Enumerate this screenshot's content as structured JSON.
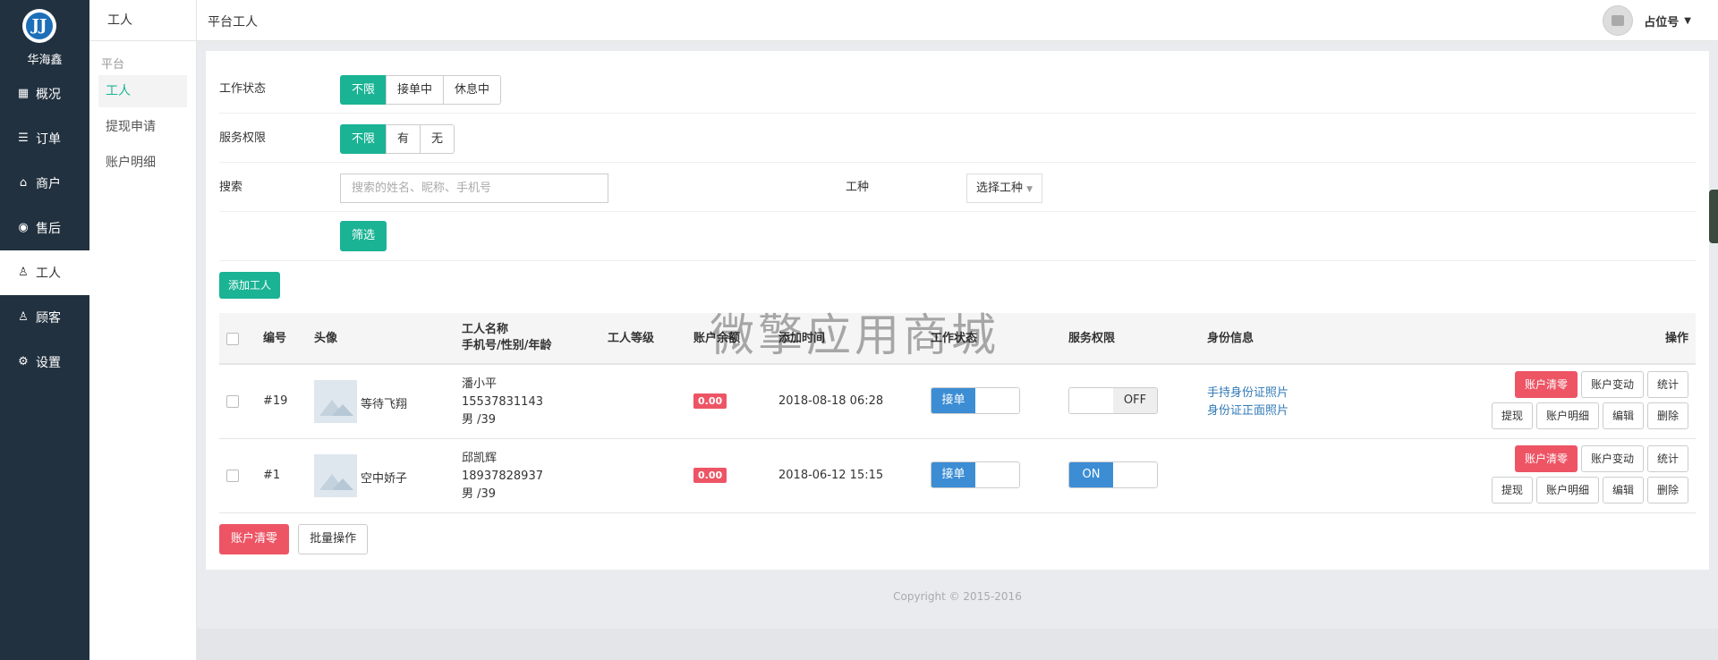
{
  "brand": {
    "name": "华海鑫"
  },
  "sidebar": {
    "items": [
      {
        "label": "概况",
        "icon": "dashboard-icon"
      },
      {
        "label": "订单",
        "icon": "document-icon"
      },
      {
        "label": "商户",
        "icon": "store-icon"
      },
      {
        "label": "售后",
        "icon": "aftersale-icon"
      },
      {
        "label": "工人",
        "icon": "user-icon",
        "active": true
      },
      {
        "label": "顾客",
        "icon": "customer-icon"
      },
      {
        "label": "设置",
        "icon": "gear-icon"
      }
    ]
  },
  "subnav": {
    "title": "工人",
    "group": "平台",
    "items": [
      {
        "label": "工人",
        "active": true
      },
      {
        "label": "提现申请"
      },
      {
        "label": "账户明细"
      }
    ]
  },
  "header": {
    "title": "平台工人",
    "user_name": "占位号"
  },
  "filters": {
    "work_status": {
      "label": "工作状态",
      "options": [
        "不限",
        "接单中",
        "休息中"
      ],
      "selected": "不限"
    },
    "service": {
      "label": "服务权限",
      "options": [
        "不限",
        "有",
        "无"
      ],
      "selected": "不限"
    },
    "search": {
      "label": "搜索",
      "placeholder": "搜索的姓名、昵称、手机号"
    },
    "type": {
      "label": "工种",
      "value": "选择工种"
    },
    "submit_label": "筛选"
  },
  "add_label": "添加工人",
  "table": {
    "headers": {
      "id": "编号",
      "avatar": "头像",
      "name_line1": "工人名称",
      "name_line2": "手机号/性别/年龄",
      "level": "工人等级",
      "balance": "账户余额",
      "time": "添加时间",
      "status": "工作状态",
      "service": "服务权限",
      "identity": "身份信息",
      "ops": "操作"
    },
    "rows": [
      {
        "id": "#19",
        "nickname": "等待飞翔",
        "name": "潘小平",
        "phone": "15537831143",
        "gender_age": "男 /39",
        "balance": "0.00",
        "time": "2018-08-18 06:28",
        "status_label": "接单",
        "service_label": "OFF",
        "id_links": [
          "手持身份证照片",
          "身份证正面照片"
        ]
      },
      {
        "id": "#1",
        "nickname": "空中娇子",
        "name": "邱凯辉",
        "phone": "18937828937",
        "gender_age": "男 /39",
        "balance": "0.00",
        "time": "2018-06-12 15:15",
        "status_label": "接单",
        "service_label": "ON",
        "id_links": []
      }
    ],
    "row_actions": {
      "clear": "账户清零",
      "change": "账户变动",
      "stats": "统计",
      "withdraw": "提现",
      "detail": "账户明细",
      "edit": "编辑",
      "delete": "删除"
    }
  },
  "bulk": {
    "clear_label": "账户清零",
    "batch_label": "批量操作"
  },
  "watermark": "微擎应用商城",
  "footer": "Copyright © 2015-2016",
  "colors": {
    "accent": "#1ab394",
    "danger": "#ed5565",
    "sidebar": "#22313f",
    "toggle_on": "#3c8dd4"
  }
}
